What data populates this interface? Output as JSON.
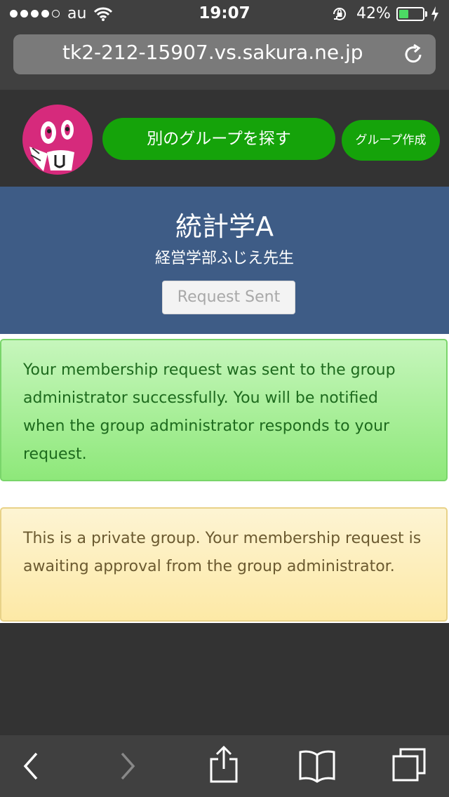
{
  "status_bar": {
    "carrier": "au",
    "time": "19:07",
    "battery_percent": "42%",
    "battery_level": 0.42,
    "signal_bars": 4
  },
  "browser": {
    "url": "tk2-212-15907.vs.sakura.ne.jp"
  },
  "nav": {
    "find_group_label": "別のグループを探す",
    "create_group_label": "グループ作成"
  },
  "group": {
    "title": "統計学A",
    "subtitle": "経営学部ふじえ先生",
    "request_button_label": "Request Sent"
  },
  "alerts": {
    "success_message": "Your membership request was sent to the group administrator successfully. You will be notified when the group administrator responds to your request.",
    "warning_message": "This is a private group. Your membership request is awaiting approval from the group administrator."
  },
  "colors": {
    "accent_green": "#15a30a",
    "banner_blue": "#3e5c86",
    "avatar_pink": "#d62a7c"
  },
  "icons": [
    "wifi-icon",
    "lock-rotation-icon",
    "charging-bolt-icon",
    "reload-icon",
    "back-icon",
    "forward-icon",
    "share-icon",
    "bookmarks-icon",
    "tabs-icon"
  ]
}
